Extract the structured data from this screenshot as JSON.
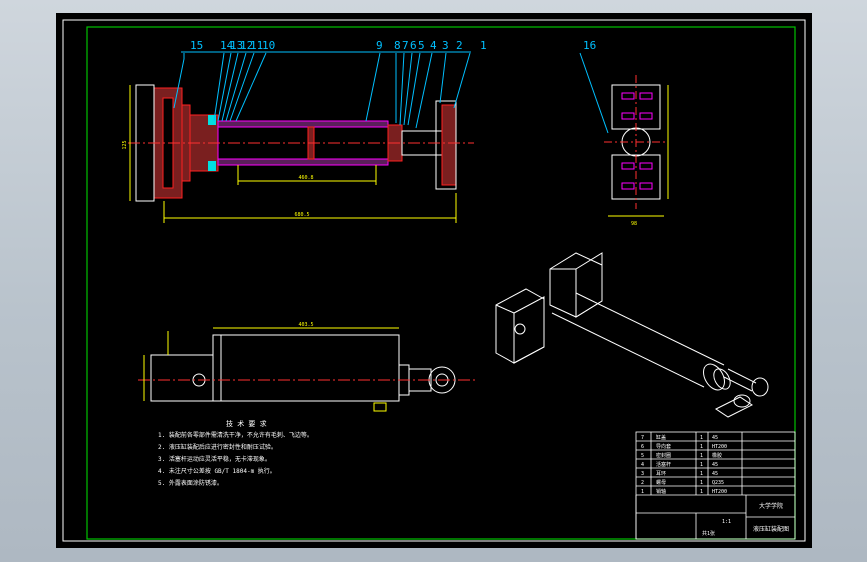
{
  "callouts_top": [
    "15",
    "14",
    "13",
    "12",
    "11",
    "10",
    "9",
    "8",
    "7",
    "6",
    "5",
    "4",
    "3",
    "2",
    "1"
  ],
  "callout_side": "16",
  "tech_title": "技 术 要 求",
  "tech_lines": [
    "1. 装配前各零部件需清洗干净，不允许有毛刺、飞边等。",
    "2. 液压缸装配后应进行密封性和耐压试验。",
    "3. 活塞杆运动应灵活平稳，无卡滞现象。",
    "4. 未注尺寸公差按 GB/T 1804-m 执行。",
    "5. 外露表面涂防锈漆。"
  ],
  "bom_rows": [
    {
      "no": "7",
      "name": "缸盖",
      "qty": "1",
      "mat": "45"
    },
    {
      "no": "6",
      "name": "导向套",
      "qty": "1",
      "mat": "HT200"
    },
    {
      "no": "5",
      "name": "密封圈",
      "qty": "1",
      "mat": "橡胶"
    },
    {
      "no": "4",
      "name": "活塞杆",
      "qty": "1",
      "mat": "45"
    },
    {
      "no": "3",
      "name": "耳环",
      "qty": "1",
      "mat": "45"
    },
    {
      "no": "2",
      "name": "螺母",
      "qty": "1",
      "mat": "Q235"
    },
    {
      "no": "1",
      "name": "销轴",
      "qty": "1",
      "mat": "HT200"
    }
  ],
  "title_block": {
    "school": "大学学院",
    "drawing_name": "液压缸装配图",
    "scale": "1:1",
    "sheet": "共1张"
  },
  "dims": {
    "total_len": "680.5",
    "stroke": "460.8",
    "bore_len": "403.5",
    "width": "125",
    "side_w": "98",
    "side_h": "125"
  }
}
